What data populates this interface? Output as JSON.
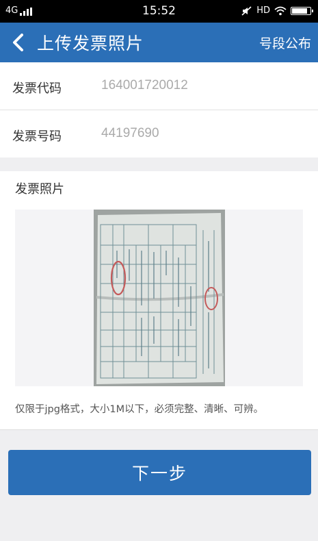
{
  "status_bar": {
    "network": "4G",
    "time": "15:52",
    "hd": "HD",
    "battery_level": 0.8
  },
  "header": {
    "title": "上传发票照片",
    "action": "号段公布",
    "back_icon": "chevron-left-icon"
  },
  "form": {
    "code_label": "发票代码",
    "code_value": "164001720012",
    "number_label": "发票号码",
    "number_value": "44197690"
  },
  "photo": {
    "title": "发票照片",
    "hint": "仅限于jpg格式，大小1M以下，必须完整、清晰、可辨。"
  },
  "next_button": "下一步",
  "colors": {
    "brand": "#2b6fb7",
    "background": "#efeff1"
  }
}
